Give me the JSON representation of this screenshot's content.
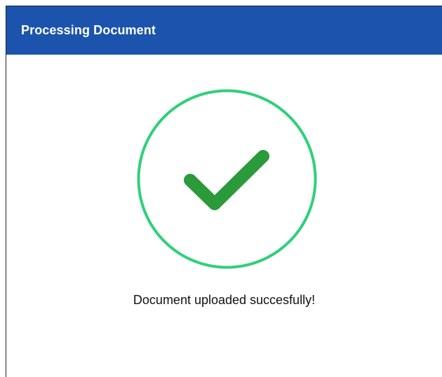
{
  "dialog": {
    "title": "Processing Document",
    "header_color": "#1c54ad"
  },
  "status": {
    "icon": "check-circle-icon",
    "ring_color": "#2fd07a",
    "check_color": "#2a9a3a",
    "message": "Document uploaded succesfully!"
  }
}
